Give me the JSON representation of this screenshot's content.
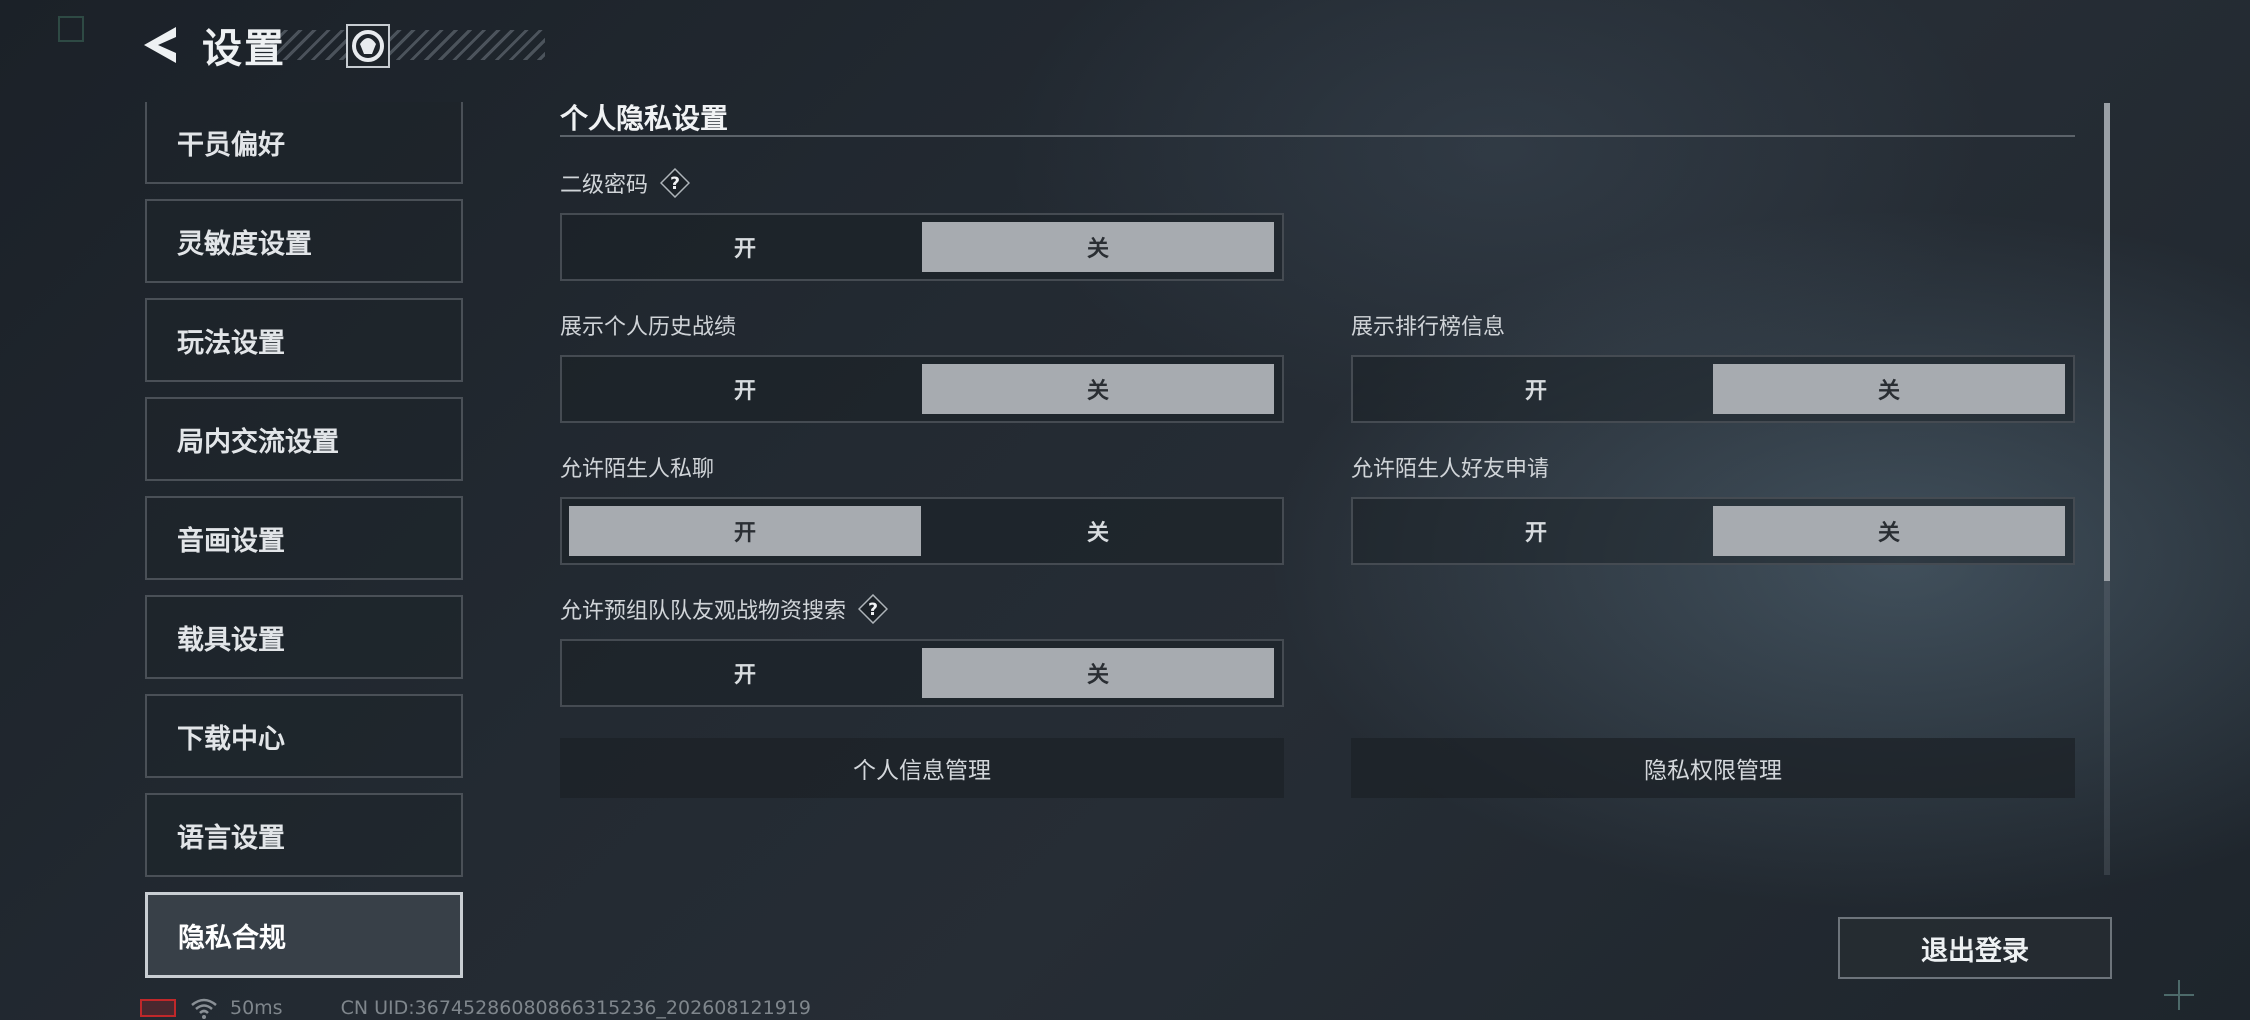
{
  "header": {
    "title": "设置"
  },
  "sidebar": {
    "items": [
      {
        "label": "干员偏好"
      },
      {
        "label": "灵敏度设置"
      },
      {
        "label": "玩法设置"
      },
      {
        "label": "局内交流设置"
      },
      {
        "label": "音画设置"
      },
      {
        "label": "载具设置"
      },
      {
        "label": "下载中心"
      },
      {
        "label": "语言设置"
      },
      {
        "label": "隐私合规",
        "active": true
      }
    ]
  },
  "privacy": {
    "section_title": "个人隐私设置",
    "on_label": "开",
    "off_label": "关",
    "settings": [
      {
        "label": "二级密码",
        "selected": "关"
      },
      {
        "label": "展示个人历史战绩",
        "selected": "关"
      },
      {
        "label": "展示排行榜信息",
        "selected": "关"
      },
      {
        "label": "允许陌生人私聊",
        "selected": "开"
      },
      {
        "label": "允许陌生人好友申请",
        "selected": "关"
      },
      {
        "label": "允许预组队队友观战物资搜索",
        "selected": "关"
      }
    ],
    "buttons": {
      "personal_info": "个人信息管理",
      "privacy_permissions": "隐私权限管理"
    }
  },
  "logout_label": "退出登录",
  "status": {
    "ping": "50ms",
    "uid": "CN UID:36745286080866315236_202608121919"
  },
  "colors": {
    "selected_option": "#a7abb0",
    "battery": "#c0282a"
  }
}
